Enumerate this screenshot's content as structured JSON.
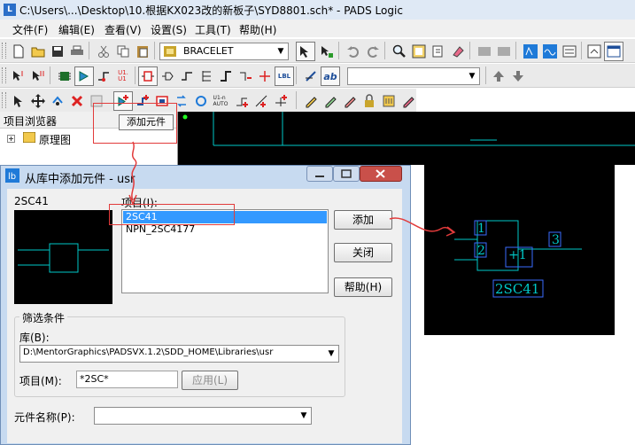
{
  "window": {
    "title": "C:\\Users\\...\\Desktop\\10.根据KX023改的新板子\\SYD8801.sch* - PADS Logic",
    "icon_label": "L"
  },
  "menu": [
    "文件(F)",
    "编辑(E)",
    "查看(V)",
    "设置(S)",
    "工具(T)",
    "帮助(H)"
  ],
  "toolbar": {
    "layer_combo_value": "BRACELET",
    "text_combo_value": "",
    "u1_label": "U1.\nU1",
    "lbl_label": "LBL",
    "ab_label": "ab",
    "v1_label": "U1-n\nAUTO"
  },
  "project_browser": {
    "title": "项目浏览器",
    "tree_item": "原理图"
  },
  "tooltip": {
    "add_component": "添加元件"
  },
  "dialog": {
    "title": "从库中添加元件 - usr",
    "preview_name": "2SC41",
    "items_label": "项目(I):",
    "items": [
      "2SC41",
      "NPN_2SC4177"
    ],
    "selected_item": "2SC41",
    "buttons": {
      "add": "添加",
      "close": "关闭",
      "help": "帮助(H)"
    },
    "filter_group": "筛选条件",
    "library_label": "库(B):",
    "library_value": "D:\\MentorGraphics\\PADSVX.1.2\\SDD_HOME\\Libraries\\usr",
    "item_filter_label": "项目(M):",
    "item_filter_value": "*2SC*",
    "apply_button": "应用(L)",
    "part_name_label": "元件名称(P):",
    "part_name_value": ""
  },
  "schematic": {
    "pin1": "1",
    "pin2": "2",
    "pin3": "3",
    "symbol_text": "+1",
    "part_name": "2SC41"
  },
  "colors": {
    "wire": "#00c8c8",
    "pin_box": "#3a6bff",
    "annotation": "#e23b3b",
    "selection": "#3399ff"
  }
}
